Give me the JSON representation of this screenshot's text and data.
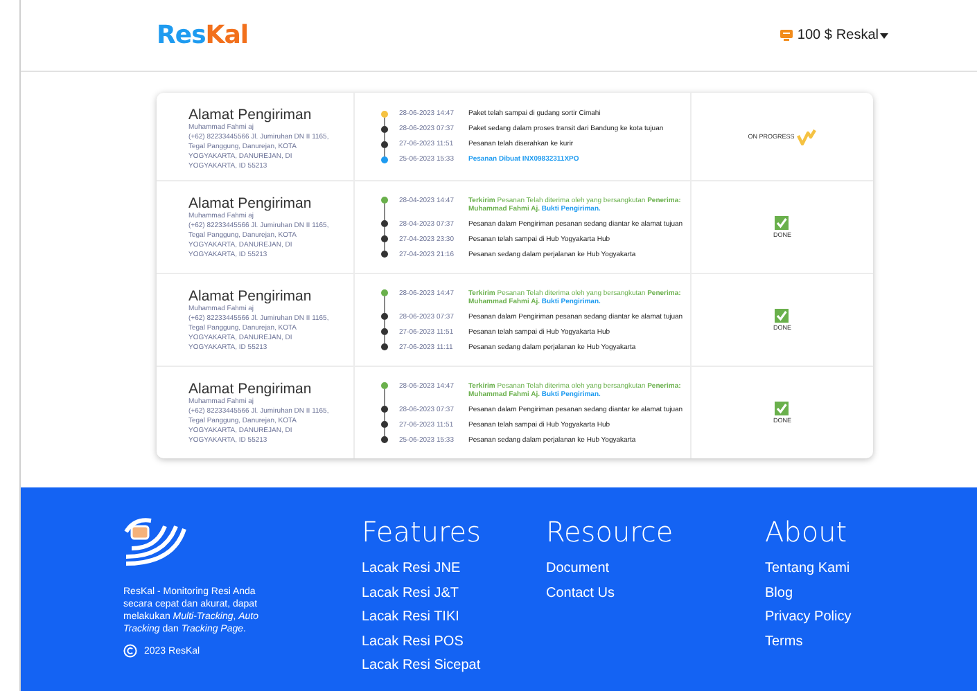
{
  "header": {
    "logo": {
      "part_1": "Res",
      "part_2": "Kal"
    },
    "balance": "100 $",
    "user": "Reskal"
  },
  "shipments": [
    {
      "title": "Alamat Pengiriman",
      "name": "Muhammad Fahmi aj",
      "address": "(+62) 82233445566 Jl. Jumiruhan DN II 1165, Tegal Panggung, Danurejan, KOTA YOGYAKARTA, DANUREJAN, DI YOGYAKARTA, ID 55213",
      "events": [
        {
          "date": "28-06-2023 14:47",
          "text": "Paket telah sampai di gudang sortir Cimahi",
          "kind": "normal",
          "color": "#f5c242"
        },
        {
          "date": "28-06-2023 07:37",
          "text": "Paket sedang dalam proses transit dari Bandung ke kota tujuan",
          "kind": "normal",
          "color": "#333333"
        },
        {
          "date": "27-06-2023 11:51",
          "text": "Pesanan telah diserahkan ke kurir",
          "kind": "normal",
          "color": "#333333"
        },
        {
          "date": "25-06-2023 15:33",
          "text": "Pesanan Dibuat INX09832311XPO",
          "kind": "created",
          "color": "#1e9bf0"
        }
      ],
      "status": {
        "kind": "in_progress",
        "label": "ON PROGRESS"
      }
    },
    {
      "title": "Alamat Pengiriman",
      "name": "Muhammad Fahmi aj",
      "address": "(+62) 82233445566 Jl. Jumiruhan DN II 1165, Tegal Panggung, Danurejan, KOTA YOGYAKARTA, DANUREJAN, DI YOGYAKARTA, ID 55213",
      "events": [
        {
          "date": "28-04-2023 14:47",
          "text": "**Terkirim** Pesanan Telah diterima oleh yang bersangkutan **Penerima: Muhammad Fahmi Aj.**",
          "link": "Bukti Pengiriman.",
          "kind": "delivered",
          "color": "#6ab04c"
        },
        {
          "date": "28-04-2023 07:37",
          "text": "Pesanan dalam Pengiriman pesanan sedang diantar ke alamat tujuan",
          "kind": "normal",
          "color": "#333333"
        },
        {
          "date": "27-04-2023 23:30",
          "text": "Pesanan telah sampai di Hub Yogyakarta Hub",
          "kind": "normal",
          "color": "#333333"
        },
        {
          "date": "27-04-2023 21:16",
          "text": "Pesanan sedang dalam perjalanan ke Hub Yogyakarta",
          "kind": "normal",
          "color": "#333333"
        }
      ],
      "status": {
        "kind": "done",
        "label": "DONE"
      }
    },
    {
      "title": "Alamat Pengiriman",
      "name": "Muhammad Fahmi aj",
      "address": "(+62) 82233445566 Jl. Jumiruhan DN II 1165, Tegal Panggung, Danurejan, KOTA YOGYAKARTA, DANUREJAN, DI YOGYAKARTA, ID 55213",
      "events": [
        {
          "date": "28-06-2023 14:47",
          "text": "**Terkirim** Pesanan Telah diterima oleh yang bersangkutan **Penerima: Muhammad Fahmi Aj.**",
          "link": "Bukti Pengiriman.",
          "kind": "delivered",
          "color": "#6ab04c"
        },
        {
          "date": "28-06-2023 07:37",
          "text": "Pesanan dalam Pengiriman pesanan sedang diantar ke alamat tujuan",
          "kind": "normal",
          "color": "#333333"
        },
        {
          "date": "27-06-2023 11:51",
          "text": "Pesanan telah sampai di Hub Yogyakarta Hub",
          "kind": "normal",
          "color": "#333333"
        },
        {
          "date": "27-06-2023 11:11",
          "text": "Pesanan sedang dalam perjalanan ke Hub Yogyakarta",
          "kind": "normal",
          "color": "#333333"
        }
      ],
      "status": {
        "kind": "done",
        "label": "DONE"
      }
    },
    {
      "title": "Alamat Pengiriman",
      "name": "Muhammad Fahmi aj",
      "address": "(+62) 82233445566 Jl. Jumiruhan DN II 1165, Tegal Panggung, Danurejan, KOTA YOGYAKARTA, DANUREJAN, DI YOGYAKARTA, ID 55213",
      "events": [
        {
          "date": "28-06-2023 14:47",
          "text": "**Terkirim** Pesanan Telah diterima oleh yang bersangkutan **Penerima: Muhammad Fahmi Aj.**",
          "link": "Bukti Pengiriman.",
          "kind": "delivered",
          "color": "#6ab04c"
        },
        {
          "date": "28-06-2023 07:37",
          "text": "Pesanan dalam Pengiriman pesanan sedang diantar ke alamat tujuan",
          "kind": "normal",
          "color": "#333333"
        },
        {
          "date": "27-06-2023 11:51",
          "text": "Pesanan telah sampai di Hub Yogyakarta Hub",
          "kind": "normal",
          "color": "#333333"
        },
        {
          "date": "25-06-2023 15:33",
          "text": "Pesanan sedang dalam perjalanan ke Hub Yogyakarta",
          "kind": "normal",
          "color": "#333333"
        }
      ],
      "status": {
        "kind": "done",
        "label": "DONE"
      }
    }
  ],
  "footer": {
    "description": "ResKal - Monitoring Resi Anda secara cepat dan akurat, dapat melakukan *Multi-Tracking*, *Auto Tracking* dan *Tracking Page*.",
    "copyright": "2023 ResKal",
    "columns": [
      {
        "heading": "Features",
        "links": [
          "Lacak Resi JNE",
          "Lacak Resi J&T",
          "Lacak Resi TIKI",
          "Lacak Resi POS",
          "Lacak Resi Sicepat"
        ]
      },
      {
        "heading": "Resource",
        "links": [
          "Document",
          "Contact Us"
        ]
      },
      {
        "heading": "About",
        "links": [
          "Tentang Kami",
          "Blog",
          "Privacy Policy",
          "Terms"
        ]
      }
    ]
  }
}
